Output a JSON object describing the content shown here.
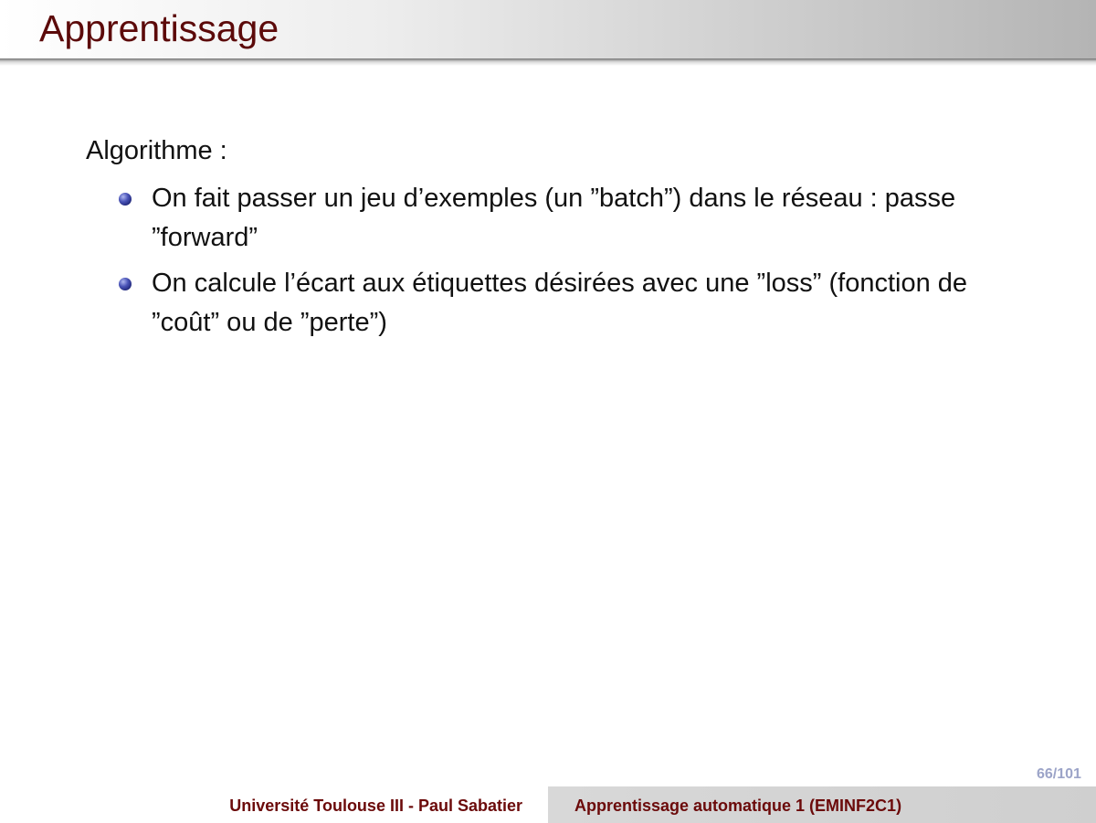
{
  "slide": {
    "title": "Apprentissage",
    "intro": "Algorithme :",
    "bullets": [
      {
        "text": "On fait passer un jeu d’exemples (un ”batch”) dans le réseau : passe ”forward”"
      },
      {
        "text": "On calcule l’écart aux étiquettes désirées avec une ”loss” (fonction de ”coût” ou de ”perte”)"
      }
    ],
    "bullet_icon": "blue-sphere-bullet-icon"
  },
  "footer": {
    "page_number": "66/101",
    "left_label": "Université Toulouse III - Paul Sabatier",
    "right_label": "Apprentissage automatique 1 (EMINF2C1)"
  },
  "colors": {
    "title": "#5c0a0a",
    "footer_text": "#6b0a0a",
    "page_number": "#9ca4c8",
    "bullet": "#2a318c"
  }
}
